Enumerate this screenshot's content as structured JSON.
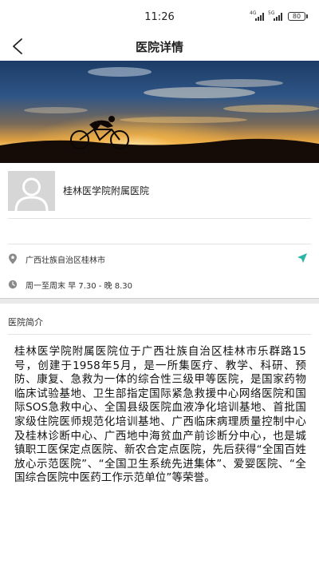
{
  "status_bar": {
    "time": "11:26",
    "net1": "4G",
    "net2": "5G",
    "battery": "80"
  },
  "nav": {
    "title": "医院详情",
    "back_icon": "chevron-left-icon"
  },
  "hospital": {
    "name": "桂林医学院附属医院",
    "avatar_icon": "user-silhouette-icon"
  },
  "info": {
    "address": "广西壮族自治区桂林市",
    "hours": "周一至周末 早 7.30 - 晚 8.30",
    "address_icon": "location-pin-icon",
    "hours_icon": "clock-icon",
    "navigate_icon": "navigation-arrow-icon",
    "accent_color": "#2bb5a5"
  },
  "intro": {
    "title": "医院简介",
    "body": "桂林医学院附属医院位于广西壮族自治区桂林市乐群路15号，创建于1958年5月，是一所集医疗、教学、科研、预防、康复、急救为一体的综合性三级甲等医院，是国家药物临床试验基地、卫生部指定国际紧急救援中心网络医院和国际SOS急救中心、全国县级医院血液净化培训基地、首批国家级住院医师规范化培训基地、广西临床病理质量控制中心及桂林诊断中心、广西地中海贫血产前诊断分中心，也是城镇职工医保定点医院、新农合定点医院，先后获得“全国百姓放心示范医院”、“全国卫生系统先进集体”、爱婴医院、“全国综合医院中医药工作示范单位”等荣誉。"
  }
}
